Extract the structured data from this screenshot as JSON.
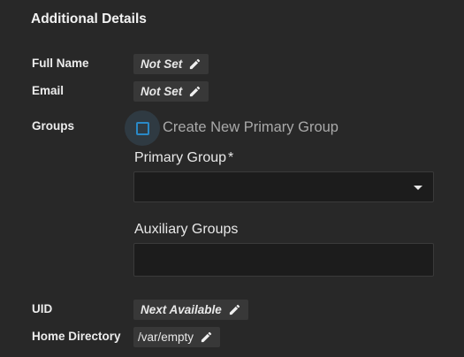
{
  "section": {
    "title": "Additional Details"
  },
  "full_name": {
    "label": "Full Name",
    "value": "Not Set",
    "edit_icon": "pencil-icon"
  },
  "email": {
    "label": "Email",
    "value": "Not Set",
    "edit_icon": "pencil-icon"
  },
  "groups": {
    "label": "Groups",
    "create_new_primary_group": {
      "label": "Create New Primary Group",
      "checked": false
    },
    "primary_group": {
      "label": "Primary Group",
      "required_marker": "*",
      "value": ""
    },
    "auxiliary_groups": {
      "label": "Auxiliary Groups",
      "value": ""
    }
  },
  "uid": {
    "label": "UID",
    "value": "Next Available",
    "edit_icon": "pencil-icon"
  },
  "home_directory": {
    "label": "Home Directory",
    "value": "/var/empty",
    "edit_icon": "pencil-icon"
  },
  "colors": {
    "background": "#282828",
    "chip": "#383838",
    "input": "#1c1c1c",
    "accent": "#2a89c7"
  }
}
